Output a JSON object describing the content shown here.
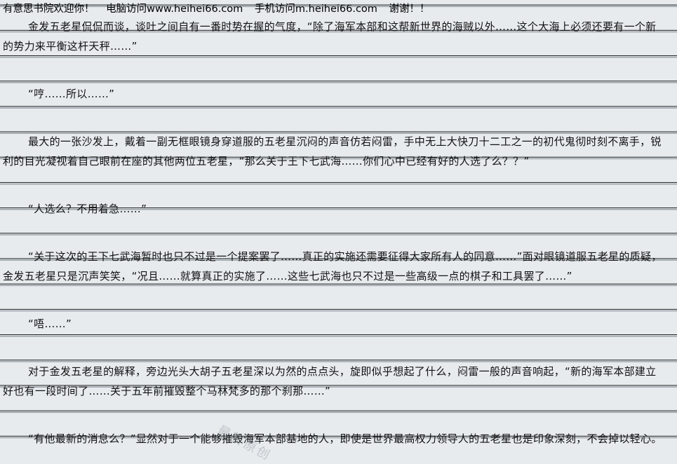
{
  "header": {
    "welcome": "有意思书院欢迎你！",
    "pc_visit": "电脑访问www.heihei66.com",
    "mobile_visit": "手机访问m.heihei66.com",
    "thanks": "谢谢！！"
  },
  "paragraphs": [
    "金发五老星侃侃而谈，谈吐之间自有一番时势在握的气度，“除了海军本部和这帮新世界的海贼以外……这个大海上必须还要有一个新的势力来平衡这杆天秤……”",
    "“哼……所以……”",
    "最大的一张沙发上，戴着一副无框眼镜身穿道服的五老星沉闷的声音仿若闷雷，手中无上大快刀十二工之一的初代鬼彻时刻不离手，锐利的目光凝视着自己眼前在座的其他两位五老星，“那么关于王下七武海……你们心中已经有好的人选了么？？”",
    "“人选么？不用着急……”",
    "“关于这次的王下七武海暂时也只不过是一个提案罢了……真正的实施还需要征得大家所有人的同意……”面对眼镜道服五老星的质疑，金发五老星只是沉声笑笑，“况且……就算真正的实施了……这些七武海也只不过是一些高级一点的棋子和工具罢了……”",
    "“唔……”",
    "对于金发五老星的解释，旁边光头大胡子五老星深以为然的点点头，旋即似乎想起了什么，闷雷一般的声音响起，“新的海军本部建立好也有一段时间了……关于五年前摧毁整个马林梵多的那个刹那……”",
    "“有他最新的消息么？”显然对于一个能够摧毁海军本部基地的人，即使是世界最高权力领导人的五老星也是印象深刻，不会掉以轻心。"
  ],
  "watermark": "最新原创"
}
